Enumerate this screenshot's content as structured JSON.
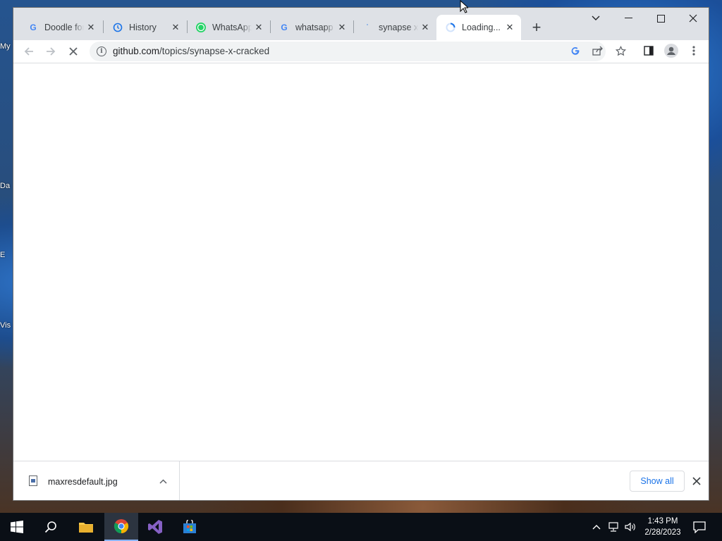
{
  "desktop": {
    "icon_labels": [
      "My",
      "Da",
      "E",
      "Vis"
    ]
  },
  "browser": {
    "tabs": [
      {
        "title": "Doodle for",
        "icon": "google-g-icon"
      },
      {
        "title": "History",
        "icon": "history-icon"
      },
      {
        "title": "WhatsApp",
        "icon": "whatsapp-icon"
      },
      {
        "title": "whatsapp",
        "icon": "google-g-icon"
      },
      {
        "title": "synapse x",
        "icon": "loading-icon"
      },
      {
        "title": "Loading...",
        "icon": "spinner-icon",
        "active": true
      }
    ],
    "new_tab_label": "+",
    "url": {
      "host": "github.com",
      "path": "/topics/synapse-x-cracked"
    },
    "download_bar": {
      "file_name": "maxresdefault.jpg",
      "show_all_label": "Show all"
    }
  },
  "taskbar": {
    "pinned": [
      "start-button",
      "search-button",
      "file-explorer",
      "chrome",
      "visual-studio",
      "microsoft-store"
    ],
    "clock": {
      "time": "1:43 PM",
      "date": "2/28/2023"
    }
  },
  "colors": {
    "accent_blue": "#1a73e8",
    "tab_strip": "#dee1e6",
    "taskbar": "#0a0f16"
  }
}
